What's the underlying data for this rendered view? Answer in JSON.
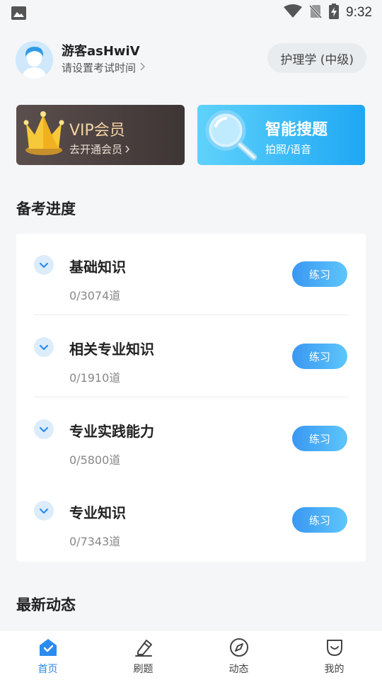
{
  "status_bar": {
    "time": "9:32"
  },
  "profile": {
    "username": "游客asHwiV",
    "exam_time_prompt": "请设置考试时间",
    "subject": "护理学 (中级)"
  },
  "cards": {
    "vip": {
      "title": "VIP会员",
      "subtitle": "去开通会员"
    },
    "search": {
      "title": "智能搜题",
      "subtitle": "拍照/语音"
    }
  },
  "progress": {
    "title": "备考进度",
    "items": [
      {
        "name": "基础知识",
        "count": "0/3074道",
        "action": "练习"
      },
      {
        "name": "相关专业知识",
        "count": "0/1910道",
        "action": "练习"
      },
      {
        "name": "专业实践能力",
        "count": "0/5800道",
        "action": "练习"
      },
      {
        "name": "专业知识",
        "count": "0/7343道",
        "action": "练习"
      }
    ]
  },
  "news": {
    "title": "最新动态"
  },
  "nav": {
    "items": [
      {
        "label": "首页",
        "icon": "home-icon",
        "active": true
      },
      {
        "label": "刷题",
        "icon": "pencil-icon",
        "active": false
      },
      {
        "label": "动态",
        "icon": "compass-icon",
        "active": false
      },
      {
        "label": "我的",
        "icon": "profile-icon",
        "active": false
      }
    ]
  },
  "colors": {
    "accent": "#2a8cf0",
    "vip_gold": "#f3d2a3"
  }
}
